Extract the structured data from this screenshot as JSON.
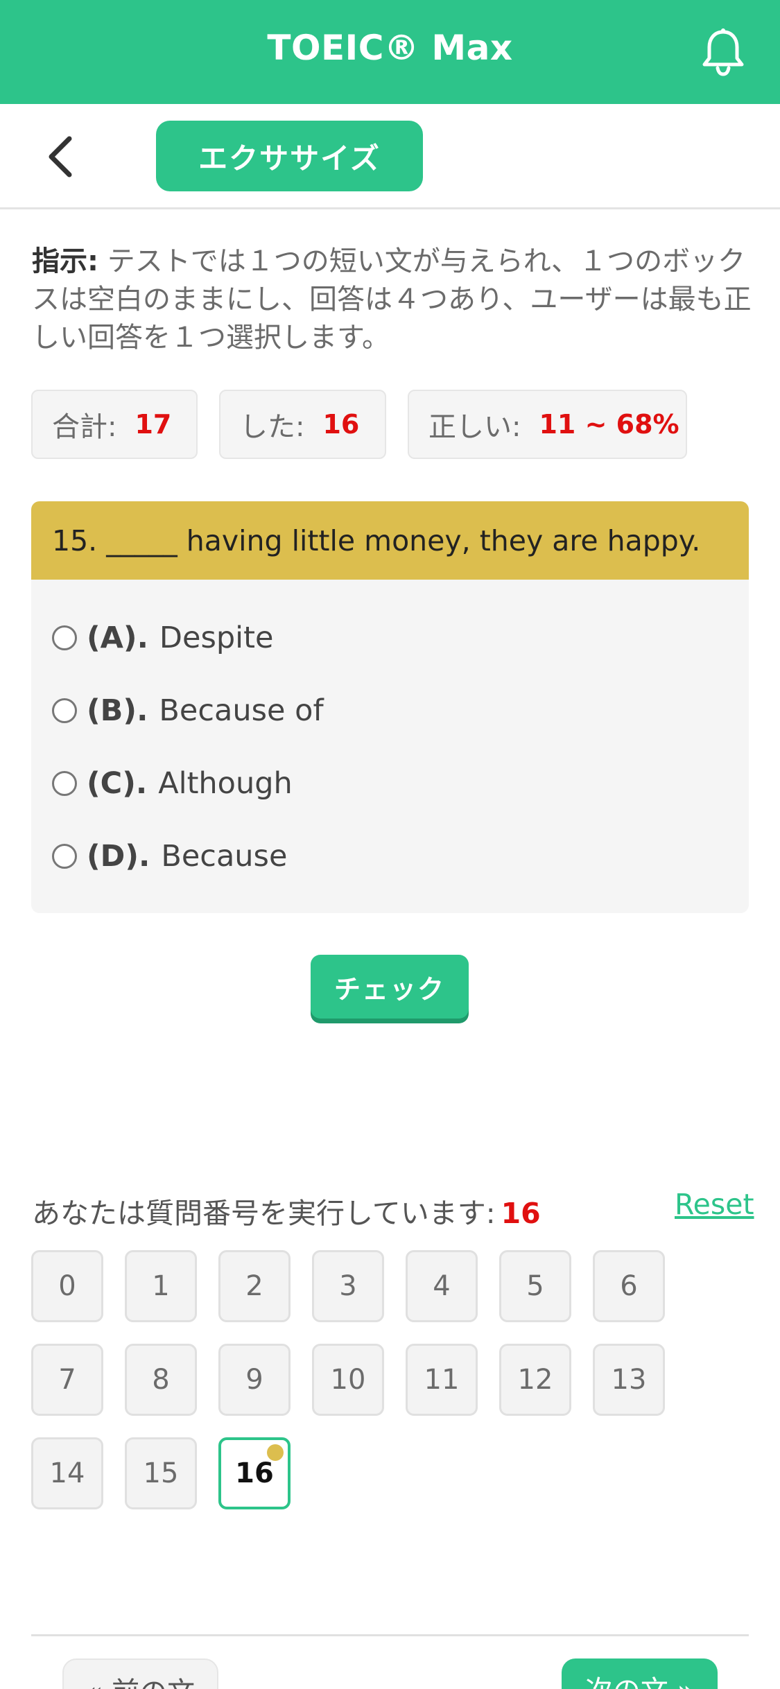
{
  "header": {
    "title": "TOEIC® Max",
    "bell_icon": "bell-icon"
  },
  "subheader": {
    "back_icon": "chevron-left-icon",
    "mode_label": "エクササイズ"
  },
  "instructions": {
    "label": "指示:",
    "text": "テストでは１つの短い文が与えられ、１つのボックスは空白のままにし、回答は４つあり、ユーザーは最も正しい回答を１つ選択します。"
  },
  "stats": {
    "total_label": "合計:",
    "total_value": "17",
    "done_label": "した:",
    "done_value": "16",
    "correct_label": "正しい:",
    "correct_value": "11 ~ 68%"
  },
  "question": {
    "text": "15. _____ having little money, they are happy.",
    "options": [
      {
        "letter": "(A).",
        "text": "Despite"
      },
      {
        "letter": "(B).",
        "text": "Because of"
      },
      {
        "letter": "(C).",
        "text": "Although"
      },
      {
        "letter": "(D).",
        "text": "Because"
      }
    ],
    "check_label": "チェック"
  },
  "progress": {
    "label": "あなたは質問番号を実行しています:",
    "current": "16",
    "reset_label": "Reset",
    "numbers": [
      "0",
      "1",
      "2",
      "3",
      "4",
      "5",
      "6",
      "7",
      "8",
      "9",
      "10",
      "11",
      "12",
      "13",
      "14",
      "15",
      "16"
    ]
  },
  "footer": {
    "prev_label": "« 前の文",
    "next_label": "次の文 »"
  },
  "colors": {
    "accent": "#2dc48a",
    "question_header": "#dcbe4e",
    "highlight": "#e01010"
  }
}
